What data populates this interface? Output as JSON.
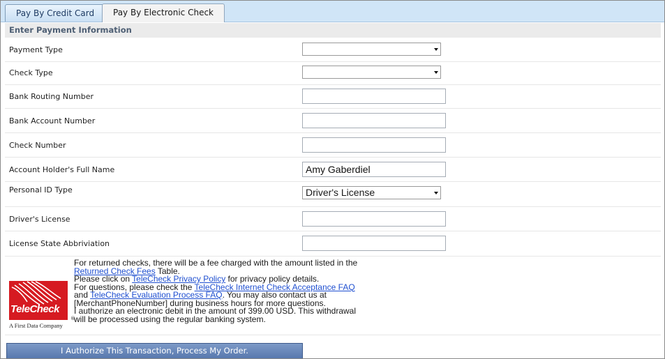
{
  "tabs": [
    {
      "label": "Pay By Credit Card",
      "active": false
    },
    {
      "label": "Pay By Electronic Check",
      "active": true
    }
  ],
  "section_title": "Enter Payment Information",
  "form": {
    "payment_type": {
      "label": "Payment Type",
      "value": ""
    },
    "check_type": {
      "label": "Check Type",
      "value": ""
    },
    "routing": {
      "label": "Bank Routing Number",
      "value": ""
    },
    "account": {
      "label": "Bank Account Number",
      "value": ""
    },
    "check_number": {
      "label": "Check Number",
      "value": ""
    },
    "full_name": {
      "label": "Account Holder's Full Name",
      "value": "Amy Gaberdiel"
    },
    "id_type": {
      "label": "Personal ID Type",
      "value": "Driver's License"
    },
    "license": {
      "label": "Driver's License",
      "value": ""
    },
    "state": {
      "label": "License State Abbriviation",
      "value": ""
    }
  },
  "notice": {
    "logo_text": "TeleCheck",
    "logo_sub": "A First Data Company",
    "reg_mark": "®",
    "p1_pre": "For returned checks, there will be a fee charged with the amount listed in the ",
    "p1_link": "Returned Check Fees",
    "p1_post": " Table.",
    "p2_pre": "Please click on ",
    "p2_link": "TeleCheck Privacy Policy",
    "p2_post": " for privacy policy details.",
    "p3_pre": "For questions, please check the ",
    "p3_link1": "TeleCheck Internet Check Acceptance FAQ",
    "p3_mid": " and ",
    "p3_link2": "TeleCheck Evaluation Process FAQ",
    "p3_post": ". You may also contact us at [MerchantPhoneNumber] during business hours for more questions.",
    "p4": "I authorize an electronic debit in the amount of 399.00 USD. This withdrawal will be processed using the regular banking system."
  },
  "submit_label": "I Authorize This Transaction, Process My Order.",
  "colors": {
    "tab_strip": "#d0e5f7",
    "section_header": "#ebebeb",
    "logo_red": "#d61a21",
    "submit_button": "#5f80b6",
    "link": "#1f4fd0"
  }
}
